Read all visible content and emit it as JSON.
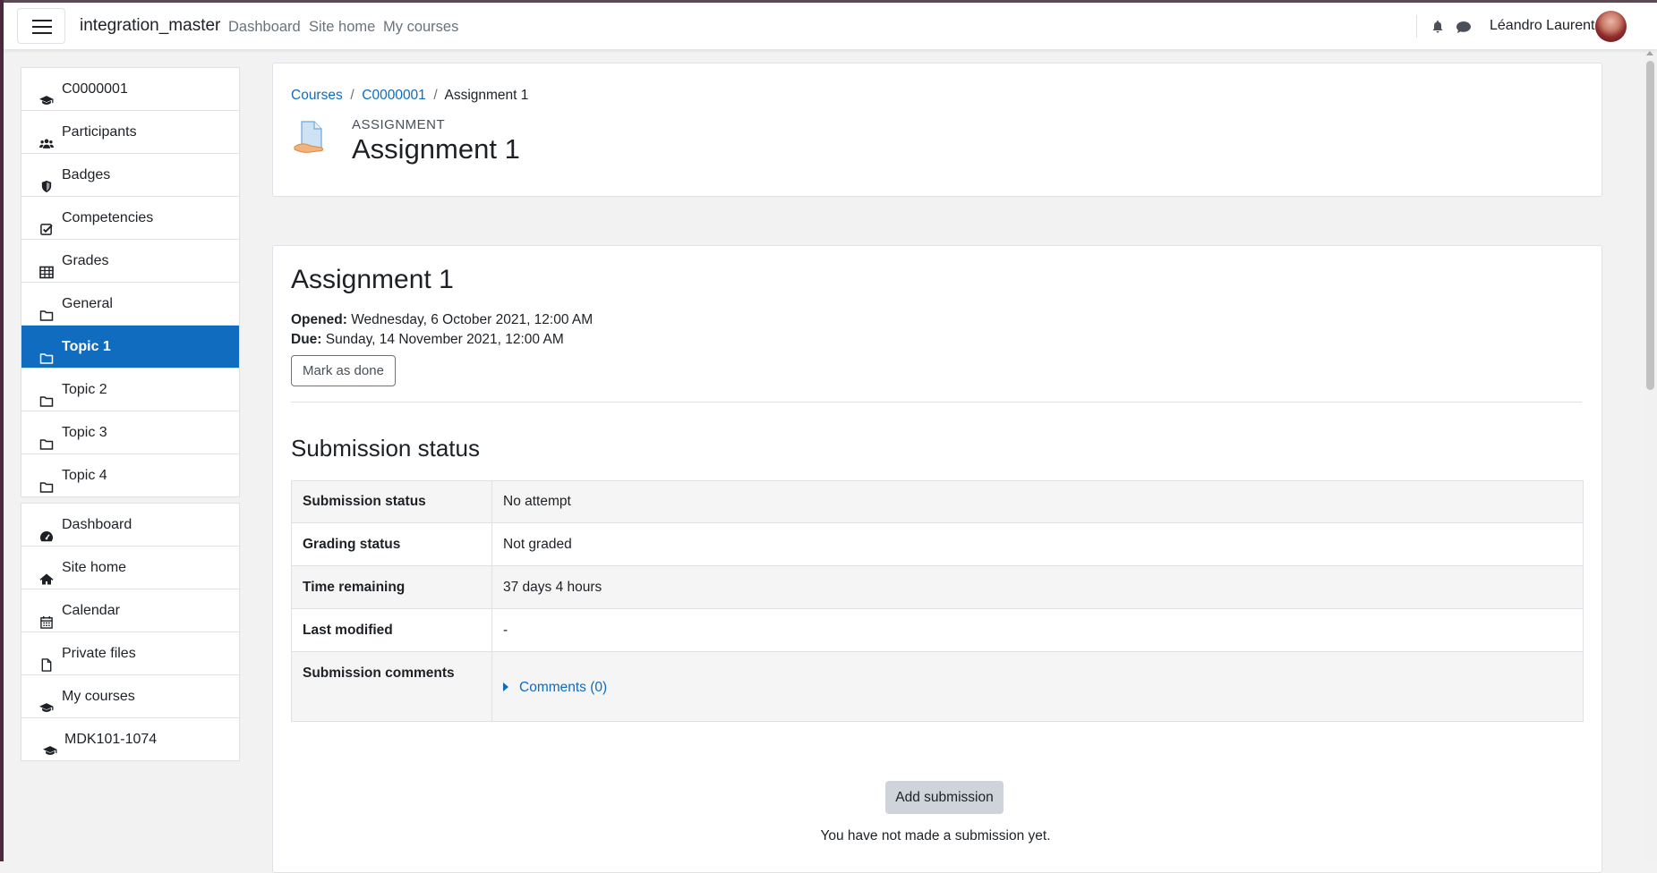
{
  "navbar": {
    "brand": "integration_master",
    "links": [
      "Dashboard",
      "Site home",
      "My courses"
    ],
    "user_name": "Léandro Laurent"
  },
  "sidebar": {
    "course_items": [
      {
        "label": "C0000001",
        "icon": "graduation-cap-icon"
      },
      {
        "label": "Participants",
        "icon": "users-icon"
      },
      {
        "label": "Badges",
        "icon": "shield-icon"
      },
      {
        "label": "Competencies",
        "icon": "check-square-icon"
      },
      {
        "label": "Grades",
        "icon": "table-icon"
      },
      {
        "label": "General",
        "icon": "folder-icon"
      },
      {
        "label": "Topic 1",
        "icon": "folder-icon",
        "active": true
      },
      {
        "label": "Topic 2",
        "icon": "folder-icon"
      },
      {
        "label": "Topic 3",
        "icon": "folder-icon"
      },
      {
        "label": "Topic 4",
        "icon": "folder-icon"
      }
    ],
    "site_items": [
      {
        "label": "Dashboard",
        "icon": "dashboard-icon"
      },
      {
        "label": "Site home",
        "icon": "home-icon"
      },
      {
        "label": "Calendar",
        "icon": "calendar-icon"
      },
      {
        "label": "Private files",
        "icon": "file-icon"
      },
      {
        "label": "My courses",
        "icon": "graduation-cap-icon"
      },
      {
        "label": "MDK101-1074",
        "icon": "graduation-cap-icon"
      }
    ]
  },
  "header": {
    "breadcrumb": [
      "Courses",
      "C0000001",
      "Assignment 1"
    ],
    "pretitle": "ASSIGNMENT",
    "title": "Assignment 1"
  },
  "main": {
    "title": "Assignment 1",
    "opened_label": "Opened:",
    "opened_value": "Wednesday, 6 October 2021, 12:00 AM",
    "due_label": "Due:",
    "due_value": "Sunday, 14 November 2021, 12:00 AM",
    "mark_done_label": "Mark as done",
    "section_title": "Submission status",
    "status_rows": [
      {
        "label": "Submission status",
        "value": "No attempt"
      },
      {
        "label": "Grading status",
        "value": "Not graded"
      },
      {
        "label": "Time remaining",
        "value": "37 days 4 hours"
      },
      {
        "label": "Last modified",
        "value": "-"
      },
      {
        "label": "Submission comments",
        "value": "Comments (0)"
      }
    ],
    "add_submission_label": "Add submission",
    "no_submission_note": "You have not made a submission yet."
  },
  "colors": {
    "accent": "#0f6cbf",
    "active_bg": "#0f6cbf",
    "page_bg": "#f2f2f2"
  }
}
